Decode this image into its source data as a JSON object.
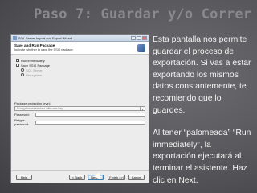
{
  "slide": {
    "title": "Paso 7: Guardar y/o Correr",
    "paragraph1": "Esta pantalla nos permite guardar el proceso de exportación. Si vas a estar exportando los mismos datos constantemente, te recomiendo que lo guardes.",
    "paragraph2": "Al tener “palomeada” “Run immediately”, la exportación ejecutará al terminar el asistente. Haz clic en Next."
  },
  "dialog": {
    "window_title": "SQL Server Import and Export Wizard",
    "header_title": "Save and Run Package",
    "header_subtitle": "Indicate whether to save the SSIS package.",
    "options": {
      "run_immediately": "Run immediately",
      "save_ssis_package": "Save SSIS Package",
      "sql_server": "SQL Server",
      "file_system": "File system"
    },
    "protection_label": "Package protection level:",
    "protection_value": "Encrypt sensitive data with user key",
    "password_label": "Password:",
    "retype_password_label": "Retype password:",
    "buttons": {
      "help": "Help",
      "back": "< Back",
      "next": "Next >",
      "finish": "Finish >>|",
      "cancel": "Cancel"
    }
  }
}
